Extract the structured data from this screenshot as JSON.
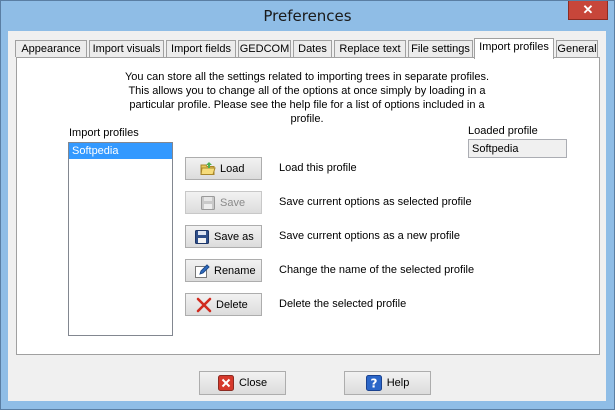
{
  "window": {
    "title": "Preferences",
    "close_glyph": "✕"
  },
  "tabs": [
    {
      "label": "Appearance"
    },
    {
      "label": "Import visuals"
    },
    {
      "label": "Import fields"
    },
    {
      "label": "GEDCOM"
    },
    {
      "label": "Dates"
    },
    {
      "label": "Replace text"
    },
    {
      "label": "File settings"
    },
    {
      "label": "Import profiles",
      "active": true
    },
    {
      "label": "General"
    }
  ],
  "intro_text": "You can store all the settings related to importing trees in separate profiles. This allows you to change all of the options at once simply by loading in a particular profile. Please see the help file for a list of options included in a profile.",
  "profiles": {
    "label": "Import profiles",
    "items": [
      "Softpedia"
    ],
    "selected_index": 0
  },
  "loaded_profile": {
    "label": "Loaded profile",
    "value": "Softpedia"
  },
  "actions": [
    {
      "label": "Load",
      "icon": "folder-open-icon",
      "description": "Load this profile",
      "enabled": true
    },
    {
      "label": "Save",
      "icon": "floppy-disk-icon",
      "description": "Save current options as selected profile",
      "enabled": false
    },
    {
      "label": "Save as",
      "icon": "floppy-disk-icon",
      "description": "Save current options as a new profile",
      "enabled": true
    },
    {
      "label": "Rename",
      "icon": "pencil-edit-icon",
      "description": "Change the name of the selected profile",
      "enabled": true
    },
    {
      "label": "Delete",
      "icon": "red-x-icon",
      "description": "Delete the selected profile",
      "enabled": true
    }
  ],
  "footer": {
    "close_label": "Close",
    "help_label": "Help"
  },
  "colors": {
    "accent": "#3399ff",
    "titlebar": "#8fbde6",
    "close_red": "#c7463a"
  }
}
